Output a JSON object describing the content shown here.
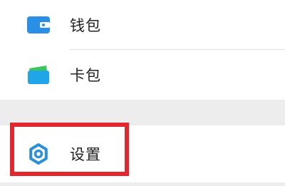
{
  "menu": {
    "wallet": {
      "label": "钱包",
      "icon": "wallet-icon",
      "icon_color": "#2b8fe6"
    },
    "cards": {
      "label": "卡包",
      "icon": "card-pack-icon",
      "icon_color": "#1fa5e8",
      "icon_accent": "#3cc45e"
    },
    "settings": {
      "label": "设置",
      "icon": "gear-icon",
      "icon_color": "#2c8fd8"
    }
  },
  "highlight": {
    "color": "#e0282e",
    "target": "settings"
  }
}
